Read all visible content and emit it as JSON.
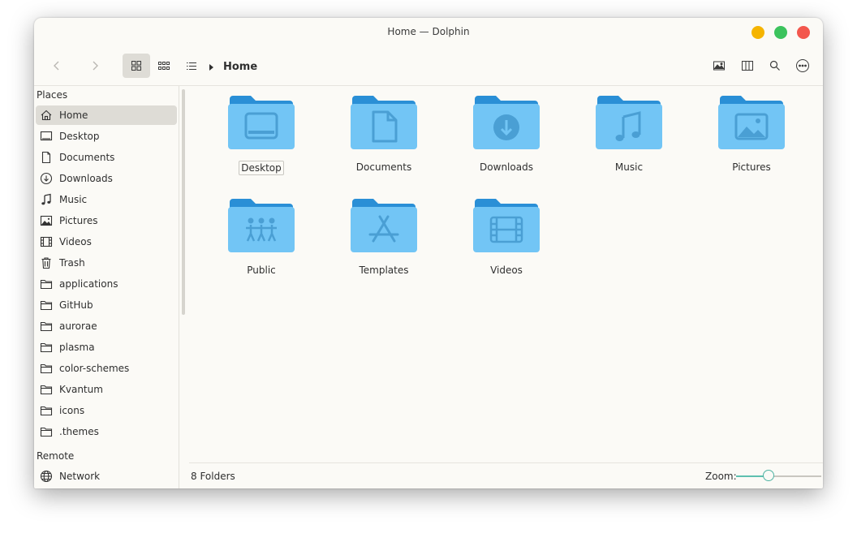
{
  "window": {
    "title": "Home — Dolphin",
    "controls": {
      "minimize_color": "#f5b400",
      "maximize_color": "#3cc35d",
      "close_color": "#f3574d"
    }
  },
  "toolbar": {
    "back_icon": "chevron-left-icon",
    "forward_icon": "chevron-right-icon",
    "view_modes": [
      "icons-view",
      "compact-view",
      "details-view"
    ],
    "active_view": "icons-view",
    "breadcrumb": "Home",
    "right_icons": [
      "preview-icon",
      "split-view-icon",
      "search-icon",
      "more-icon"
    ]
  },
  "sidebar": {
    "places_header": "Places",
    "places": [
      {
        "label": "Home",
        "icon": "home-icon",
        "active": true
      },
      {
        "label": "Desktop",
        "icon": "desktop-icon"
      },
      {
        "label": "Documents",
        "icon": "document-icon"
      },
      {
        "label": "Downloads",
        "icon": "download-icon"
      },
      {
        "label": "Music",
        "icon": "music-icon"
      },
      {
        "label": "Pictures",
        "icon": "picture-icon"
      },
      {
        "label": "Videos",
        "icon": "video-icon"
      },
      {
        "label": "Trash",
        "icon": "trash-icon"
      },
      {
        "label": "applications",
        "icon": "folder-icon"
      },
      {
        "label": "GitHub",
        "icon": "folder-icon"
      },
      {
        "label": "aurorae",
        "icon": "folder-icon"
      },
      {
        "label": "plasma",
        "icon": "folder-icon"
      },
      {
        "label": "color-schemes",
        "icon": "folder-icon"
      },
      {
        "label": "Kvantum",
        "icon": "folder-icon"
      },
      {
        "label": "icons",
        "icon": "folder-icon"
      },
      {
        "label": ".themes",
        "icon": "folder-icon"
      }
    ],
    "remote_header": "Remote",
    "remote": [
      {
        "label": "Network",
        "icon": "network-icon"
      }
    ]
  },
  "main": {
    "folders": [
      {
        "label": "Desktop",
        "emblem": "desktop-emblem-icon",
        "focused": true
      },
      {
        "label": "Documents",
        "emblem": "document-emblem-icon"
      },
      {
        "label": "Downloads",
        "emblem": "download-emblem-icon"
      },
      {
        "label": "Music",
        "emblem": "music-emblem-icon"
      },
      {
        "label": "Pictures",
        "emblem": "picture-emblem-icon"
      },
      {
        "label": "Public",
        "emblem": "people-emblem-icon"
      },
      {
        "label": "Templates",
        "emblem": "templates-emblem-icon"
      },
      {
        "label": "Videos",
        "emblem": "video-emblem-icon"
      }
    ],
    "folder_colors": {
      "back": "#2a8fd6",
      "front": "#72c5f5",
      "emblem": "#4a9fd4"
    }
  },
  "statusbar": {
    "summary": "8 Folders",
    "zoom_label": "Zoom:",
    "zoom_fraction": 0.38,
    "accent_color": "#4fb3a3"
  }
}
